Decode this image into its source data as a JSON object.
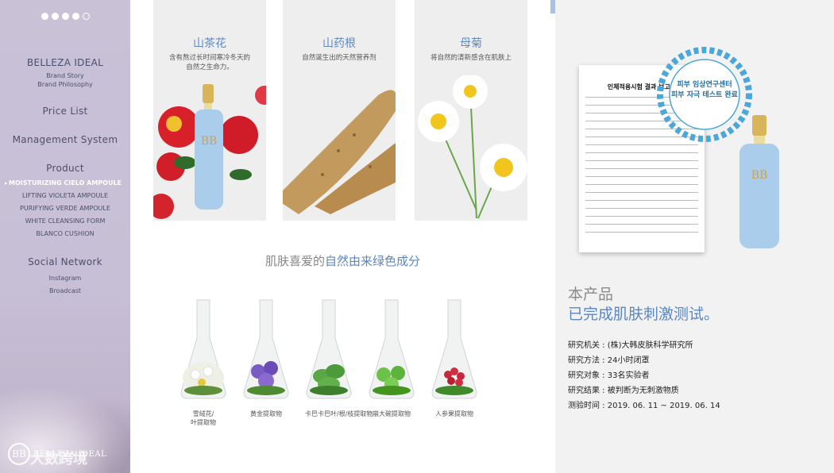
{
  "sidebar": {
    "brand_title": "BELLEZA IDEAL",
    "brand_subs": [
      "Brand Story",
      "Brand Philosophy"
    ],
    "price_list": "Price List",
    "management": "Management System",
    "product_title": "Product",
    "products": [
      "MOISTURIZING CIELO AMPOULE",
      "LIFTING VIOLETA AMPOULE",
      "PURIFYING VERDE AMPOULE",
      "WHITE CLEANSING FORM",
      "BLANCO CUSHION"
    ],
    "active_arrow": "▸",
    "social_title": "Social Network",
    "social_items": [
      "Instagram",
      "Broadcast"
    ],
    "logo_mark": "BB",
    "logo_text": "BELLEZA IDEAL",
    "watermark": "大数跨境"
  },
  "cards": [
    {
      "title": "山茶花",
      "desc": [
        "含有熬过长时间寒冷冬天的",
        "自然之生命力。"
      ]
    },
    {
      "title": "山药根",
      "desc": [
        "自然诞生出的天然营养剂"
      ]
    },
    {
      "title": "母菊",
      "desc": [
        "将自然的清新感含在肌肤上"
      ]
    }
  ],
  "headline": {
    "part1": "肌肤喜爱的",
    "part2": "自然由来绿色成分"
  },
  "flasks": [
    {
      "label": [
        "雪绒花/",
        "叶提取物"
      ],
      "color": "#f4f4f0",
      "accent": "#e7c83a"
    },
    {
      "label": [
        "黄金提取物"
      ],
      "color": "#7a5bc4",
      "accent": "#5a3aa0"
    },
    {
      "label": [
        "卡巴卡巴叶/根/枝提取物"
      ],
      "color": "#5aa845",
      "accent": "#3e7f2e"
    },
    {
      "label": [
        "崩大碗提取物"
      ],
      "color": "#6cc14a",
      "accent": "#43951f"
    },
    {
      "label": [
        "人参果提取物"
      ],
      "color": "#c8283a",
      "accent": "#3f8a2a"
    }
  ],
  "right": {
    "doc_title": "인체적용시험 결과 보고서",
    "badge_line1": "피부 임상연구센터",
    "badge_line2": "피부 자극 테스트 완료",
    "heading1": "本产品",
    "heading2": "已完成肌肤刺激测试。",
    "info": [
      "研究机关 : (株)大韩皮肤科学研究所",
      "研究方法 : 24小时闭罩",
      "研究对象 : 33名实验者",
      "研究结果 : 被判断为无刺激物质",
      "测验时间 : 2019. 06. 11 ~ 2019. 06. 14"
    ]
  }
}
